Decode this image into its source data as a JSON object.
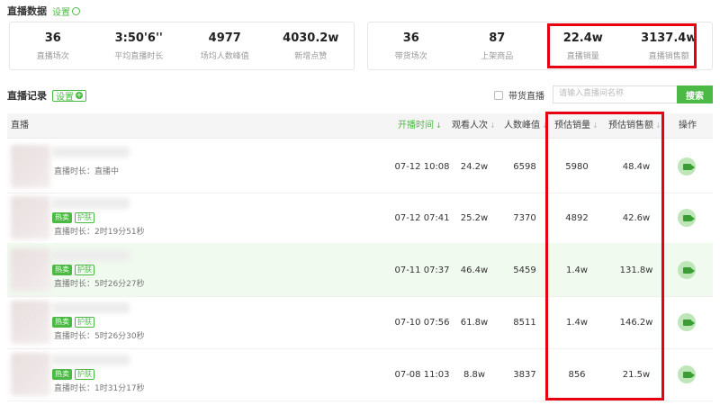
{
  "overview": {
    "title": "直播数据",
    "settings_label": "设置",
    "left_stats": [
      {
        "value": "36",
        "label": "直播场次"
      },
      {
        "value": "3:50'6''",
        "label": "平均直播时长"
      },
      {
        "value": "4977",
        "label": "场均人数峰值"
      },
      {
        "value": "4030.2w",
        "label": "新增点赞"
      }
    ],
    "right_stats": [
      {
        "value": "36",
        "label": "带货场次"
      },
      {
        "value": "87",
        "label": "上架商品"
      },
      {
        "value": "22.4w",
        "label": "直播销量"
      },
      {
        "value": "3137.4w",
        "label": "直播销售额"
      }
    ]
  },
  "records": {
    "title": "直播记录",
    "settings_label": "设置",
    "filter_label": "带货直播",
    "search_placeholder": "请输入直播间名称",
    "search_button": "搜索"
  },
  "table": {
    "headers": {
      "live": "直播",
      "start_time": "开播时间",
      "viewers": "观看人次",
      "peak": "人数峰值",
      "est_sales": "预估销量",
      "est_revenue": "预估销售额",
      "ops": "操作"
    },
    "sort_arrow": "↓",
    "rows": [
      {
        "tag_hot": "",
        "tag_cat": "",
        "duration": "直播时长：直播中",
        "start_time": "07-12 10:08",
        "viewers": "24.2w",
        "peak": "6598",
        "est_sales": "5980",
        "est_revenue": "48.4w"
      },
      {
        "tag_hot": "热卖",
        "tag_cat": "护肤",
        "duration": "直播时长：2时19分51秒",
        "start_time": "07-12 07:41",
        "viewers": "25.2w",
        "peak": "7370",
        "est_sales": "4892",
        "est_revenue": "42.6w"
      },
      {
        "tag_hot": "热卖",
        "tag_cat": "护肤",
        "duration": "直播时长：5时26分27秒",
        "start_time": "07-11 07:37",
        "viewers": "46.4w",
        "peak": "5459",
        "est_sales": "1.4w",
        "est_revenue": "131.8w"
      },
      {
        "tag_hot": "热卖",
        "tag_cat": "护肤",
        "duration": "直播时长：5时26分30秒",
        "start_time": "07-10 07:56",
        "viewers": "61.8w",
        "peak": "8511",
        "est_sales": "1.4w",
        "est_revenue": "146.2w"
      },
      {
        "tag_hot": "热卖",
        "tag_cat": "护肤",
        "duration": "直播时长：1时31分17秒",
        "start_time": "07-08 11:03",
        "viewers": "8.8w",
        "peak": "3837",
        "est_sales": "856",
        "est_revenue": "21.5w"
      }
    ]
  },
  "colors": {
    "accent": "#4cb946",
    "highlight_border": "#e60012"
  }
}
